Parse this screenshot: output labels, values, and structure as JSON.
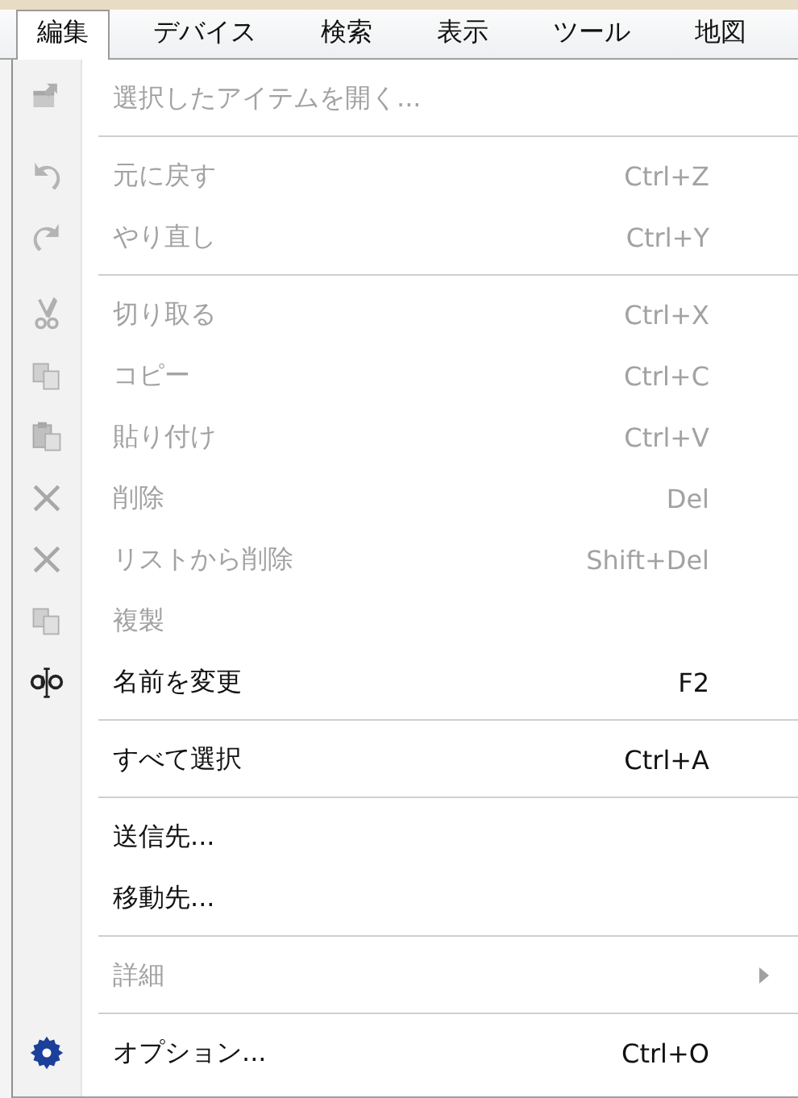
{
  "menubar": [
    {
      "label": "編集",
      "selected": true
    },
    {
      "label": "デバイス",
      "selected": false
    },
    {
      "label": "検索",
      "selected": false
    },
    {
      "label": "表示",
      "selected": false
    },
    {
      "label": "ツール",
      "selected": false
    },
    {
      "label": "地図",
      "selected": false
    }
  ],
  "menu": {
    "entries": [
      {
        "kind": "item",
        "label": "選択したアイテムを開く...",
        "disabled": true
      },
      {
        "kind": "separator"
      },
      {
        "kind": "item",
        "label": "元に戻す",
        "shortcut": "Ctrl+Z",
        "disabled": true
      },
      {
        "kind": "item",
        "label": "やり直し",
        "shortcut": "Ctrl+Y",
        "disabled": true
      },
      {
        "kind": "separator"
      },
      {
        "kind": "item",
        "label": "切り取る",
        "shortcut": "Ctrl+X",
        "disabled": true
      },
      {
        "kind": "item",
        "label": "コピー",
        "shortcut": "Ctrl+C",
        "disabled": true
      },
      {
        "kind": "item",
        "label": "貼り付け",
        "shortcut": "Ctrl+V",
        "disabled": true
      },
      {
        "kind": "item",
        "label": "削除",
        "shortcut": "Del",
        "disabled": true
      },
      {
        "kind": "item",
        "label": "リストから削除",
        "shortcut": "Shift+Del",
        "disabled": true
      },
      {
        "kind": "item",
        "label": "複製",
        "disabled": true
      },
      {
        "kind": "item",
        "label": "名前を変更",
        "shortcut": "F2",
        "disabled": false
      },
      {
        "kind": "separator"
      },
      {
        "kind": "item",
        "label": "すべて選択",
        "shortcut": "Ctrl+A",
        "disabled": false
      },
      {
        "kind": "separator"
      },
      {
        "kind": "item",
        "label": "送信先...",
        "disabled": false
      },
      {
        "kind": "item",
        "label": "移動先...",
        "disabled": false
      },
      {
        "kind": "separator"
      },
      {
        "kind": "item",
        "label": "詳細",
        "disabled": true,
        "submenu": true
      },
      {
        "kind": "separator"
      },
      {
        "kind": "item",
        "label": "オプション...",
        "shortcut": "Ctrl+O",
        "disabled": false
      }
    ]
  }
}
